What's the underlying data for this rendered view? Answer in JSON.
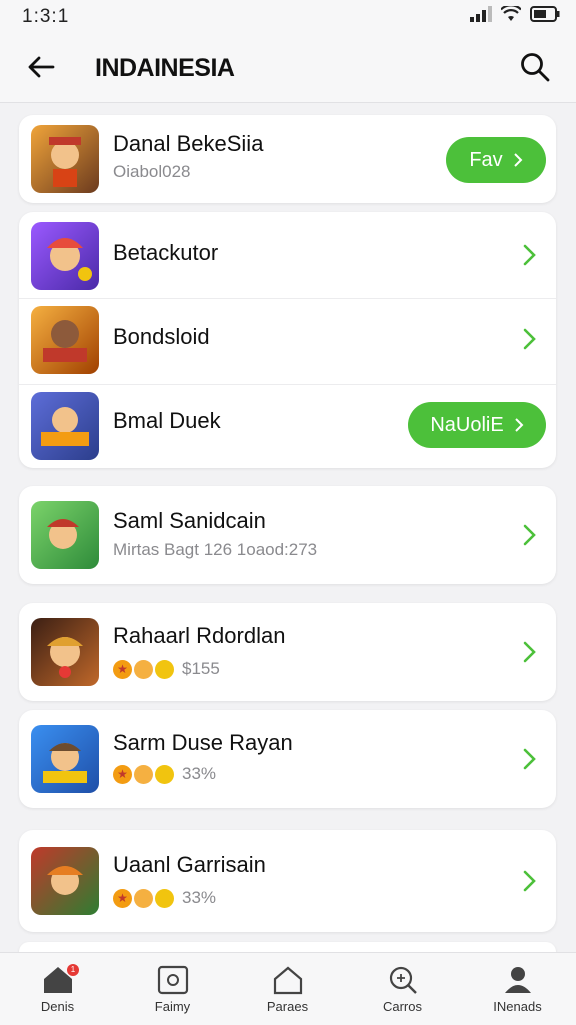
{
  "status": {
    "time": "1:3:1"
  },
  "header": {
    "title": "INDAINESIA"
  },
  "items": [
    {
      "name": "Danal BekeSiia",
      "sub": "Oiabol028",
      "action": "Fav"
    },
    {
      "name": "Betackutor"
    },
    {
      "name": "Bondsloid"
    },
    {
      "name": "Bmal Duek",
      "action": "NaUoliE"
    },
    {
      "name": "Saml Sanidcain",
      "sub": "Mirtas Bagt 126 1oaod:273"
    },
    {
      "name": "Rahaarl Rdordlan",
      "price": "$155"
    },
    {
      "name": "Sarm Duse Rayan",
      "price": "33%"
    },
    {
      "name": "Uaanl Garrisain",
      "price": "33%"
    }
  ],
  "nav": [
    {
      "label": "Denis",
      "badge": "1"
    },
    {
      "label": "Faimy"
    },
    {
      "label": "Paraes"
    },
    {
      "label": "Carros"
    },
    {
      "label": "INenads"
    }
  ],
  "colors": {
    "accent": "#4cc03a",
    "badge": "#e53935"
  }
}
